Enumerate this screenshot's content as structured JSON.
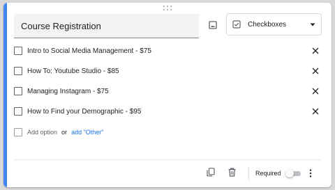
{
  "question": {
    "title": "Course Registration",
    "type_label": "Checkboxes"
  },
  "options": [
    {
      "label": "Intro to Social Media Management - $75"
    },
    {
      "label": "How To: Youtube Studio - $85"
    },
    {
      "label": "Managing Instagram - $75"
    },
    {
      "label": "How to Find your Demographic - $95"
    }
  ],
  "add_row": {
    "add_option": "Add option",
    "or": "or",
    "add_other": "add \"Other\""
  },
  "footer": {
    "required_label": "Required",
    "required_on": false
  },
  "icons": {
    "drag": "drag-handle-icon",
    "image": "image-icon",
    "type": "checkbox-icon",
    "dropdown": "caret-down-icon",
    "remove": "close-icon",
    "duplicate": "copy-icon",
    "delete": "trash-icon",
    "more": "more-vert-icon"
  },
  "colors": {
    "accent": "#4285f4",
    "link": "#1a73e8"
  }
}
